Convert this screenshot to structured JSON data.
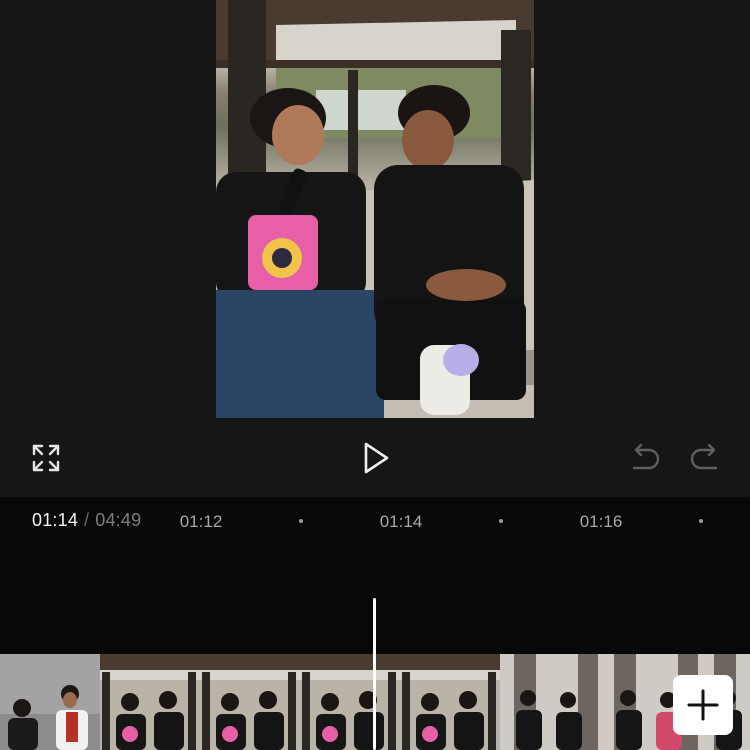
{
  "app": {
    "screen": "video-editor"
  },
  "preview": {
    "scene": "two people sitting on a bench in a courtyard"
  },
  "controls": {
    "fullscreen_icon": "expand-icon",
    "play_icon": "play-icon",
    "undo_icon": "undo-icon",
    "redo_icon": "redo-icon"
  },
  "timecode": {
    "current": "01:14",
    "separator": "/",
    "total": "04:49"
  },
  "ruler": {
    "labels": [
      "01:12",
      "01:14",
      "01:16"
    ]
  },
  "timeline": {
    "add_clip_icon": "plus-icon"
  },
  "colors": {
    "background": "#151516",
    "timeline_background": "#080808",
    "playhead": "#ffffff",
    "add_button": "#ffffff"
  }
}
